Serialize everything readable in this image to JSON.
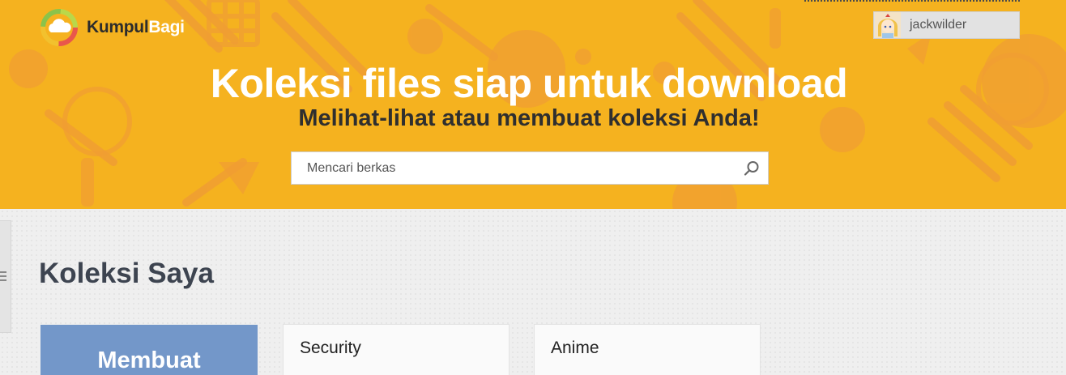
{
  "brand": {
    "name_part1": "Kumpul",
    "name_part2": "Bagi"
  },
  "user": {
    "username": "jackwilder"
  },
  "hero": {
    "title": "Koleksi files siap untuk download",
    "subtitle": "Melihat-lihat atau membuat koleksi Anda!"
  },
  "search": {
    "placeholder": "Mencari berkas",
    "value": ""
  },
  "main": {
    "section_title": "Koleksi Saya",
    "create_label": "Membuat",
    "collections": [
      {
        "title": "Security"
      },
      {
        "title": "Anime"
      }
    ]
  },
  "colors": {
    "hero_bg": "#f5b21f",
    "create_card": "#7397c9",
    "heading": "#3d4450"
  },
  "icons": [
    "cloud-logo-icon",
    "user-avatar-icon",
    "search-icon",
    "menu-lines-icon"
  ]
}
